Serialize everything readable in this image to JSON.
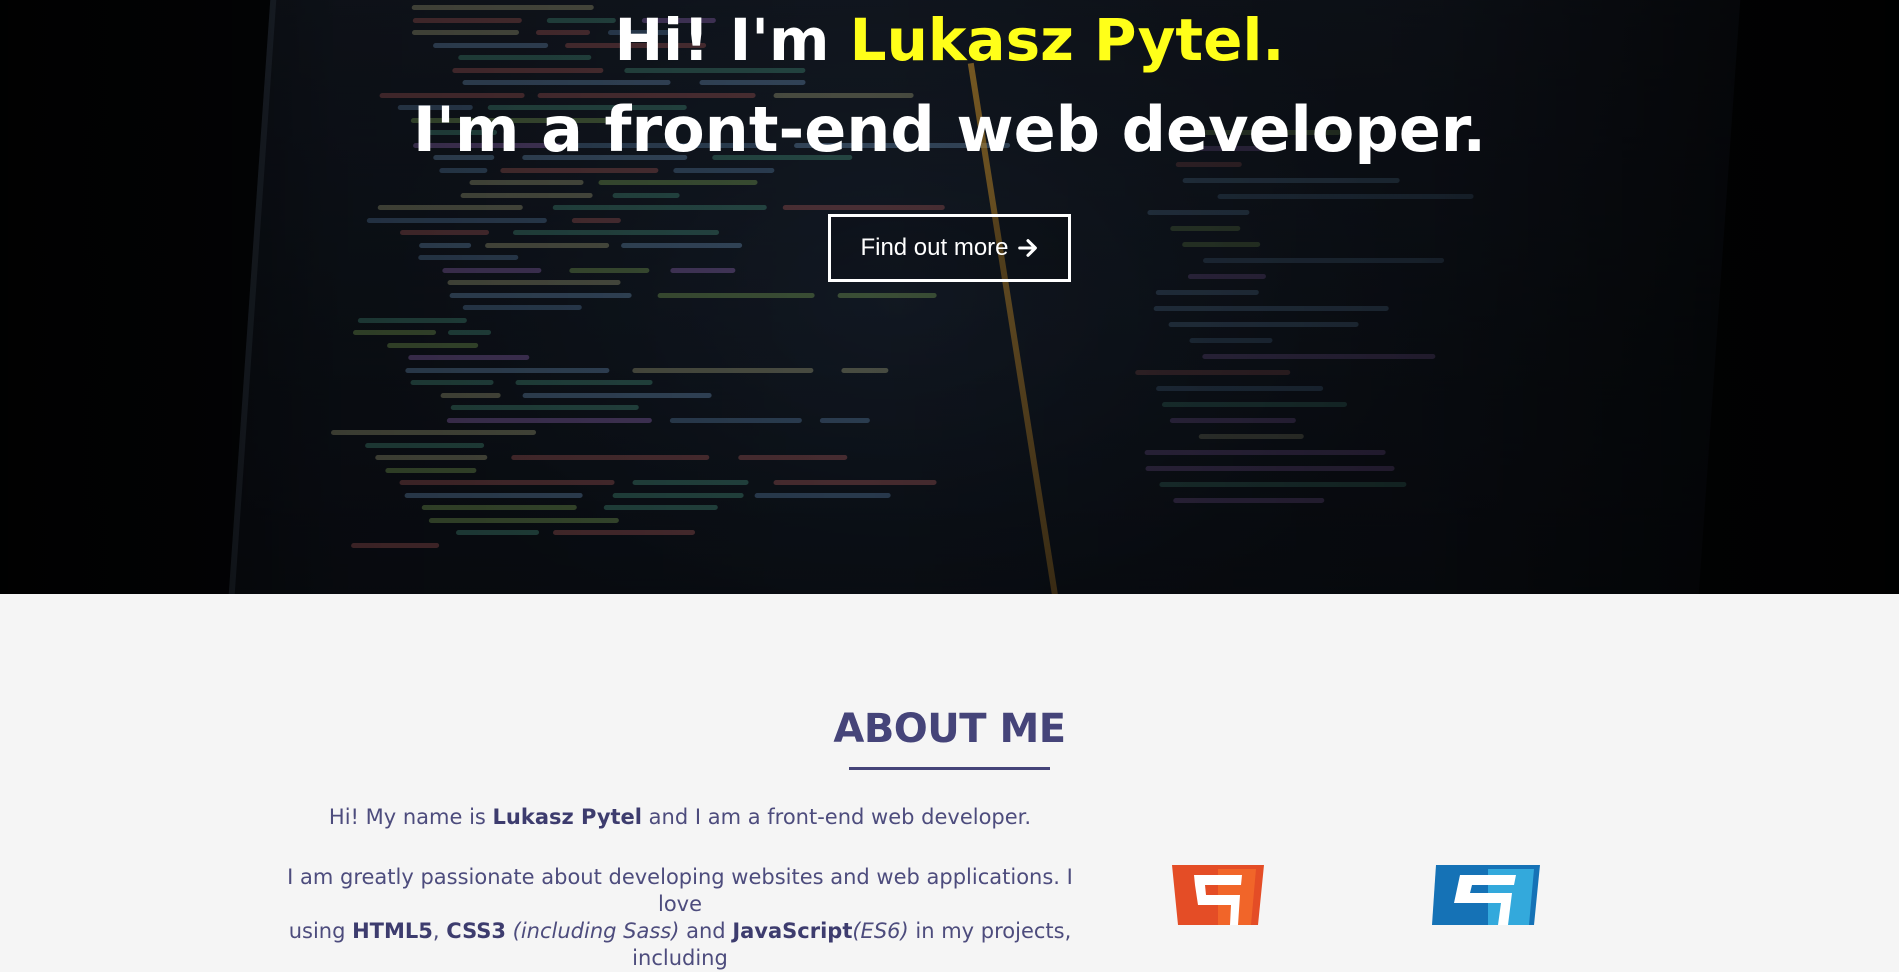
{
  "hero": {
    "greeting_prefix": "Hi! I'm ",
    "greeting_name": "Lukasz Pytel.",
    "subtitle": "I'm a front-end web developer.",
    "cta_label": "Find out more",
    "cta_icon": "arrow-right-icon"
  },
  "about": {
    "heading": "ABOUT ME",
    "intro_prefix": "Hi! My name is ",
    "intro_name": "Lukasz Pytel",
    "intro_suffix": " and I am a front-end web developer.",
    "passion_text": "I am greatly passionate about developing websites and web applications. I love",
    "tech_prefix": "using ",
    "tech_html": "HTML5",
    "tech_sep1": ", ",
    "tech_css": "CSS3",
    "tech_sass": " (including Sass)",
    "tech_and": " and ",
    "tech_js": "JavaScript",
    "tech_es6": "(ES6)",
    "tech_suffix": " in my projects, including",
    "skill_icons": [
      "html5-logo-icon",
      "css3-logo-icon"
    ]
  },
  "colors": {
    "accent_yellow": "#ffff19",
    "about_heading": "#454479",
    "about_text": "#4d4c7d",
    "html5_orange": "#e44d26",
    "css3_blue": "#1572b6"
  }
}
